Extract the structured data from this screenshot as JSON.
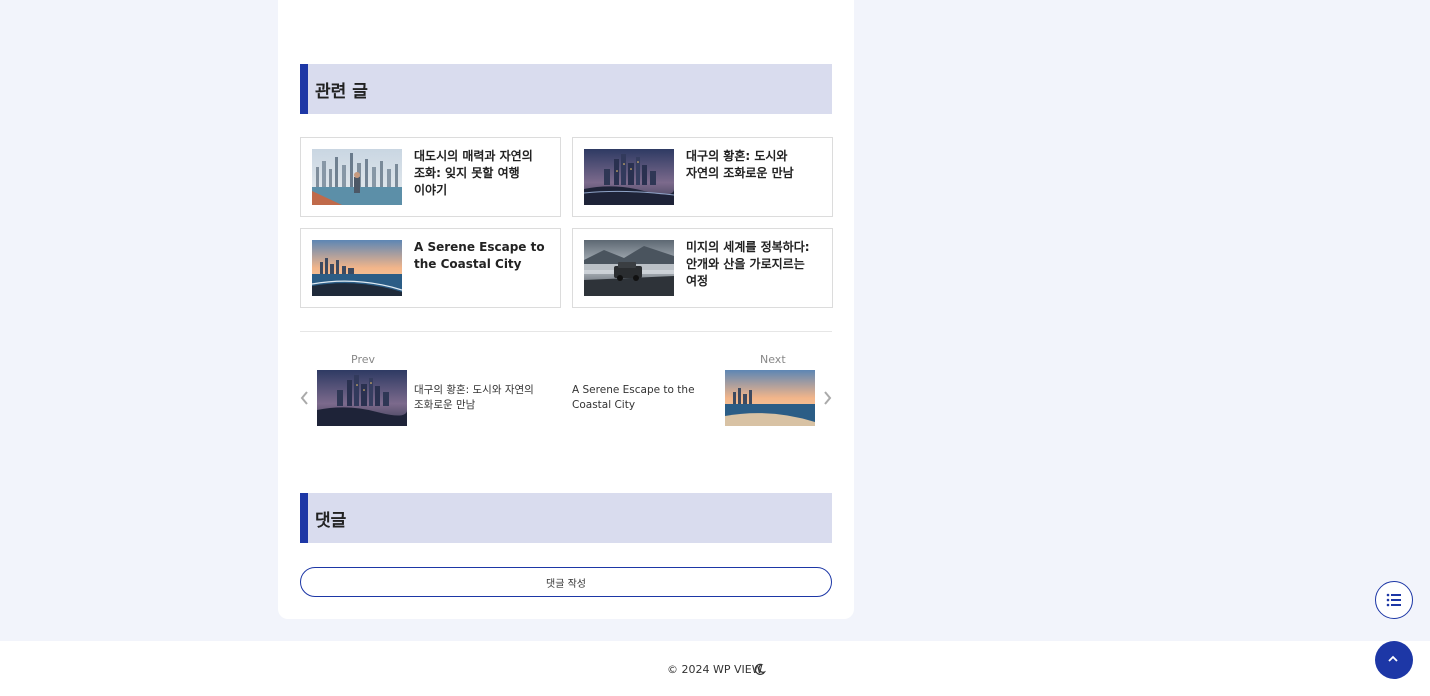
{
  "related": {
    "heading": "관련 글",
    "items": [
      {
        "title": "대도시의 매력과 자연의 조화: 잊지 못할 여행 이야기",
        "thumb": "city-waterfront-photo"
      },
      {
        "title": "대구의 황혼: 도시와 자연의 조화로운 만남",
        "thumb": "city-dusk-skyline-photo"
      },
      {
        "title": "A Serene Escape to the Coastal City",
        "thumb": "coastal-sunset-photo"
      },
      {
        "title": "미지의 세계를 정복하다: 안개와 산을 가로지르는 여정",
        "thumb": "suv-mountain-fog-photo"
      }
    ]
  },
  "post_nav": {
    "prev_label": "Prev",
    "prev_title": "대구의 황혼: 도시와 자연의 조화로운 만남",
    "next_label": "Next",
    "next_title": "A Serene Escape to the Coastal City"
  },
  "comments": {
    "heading": "댓글",
    "write_button": "댓글 작성"
  },
  "footer": {
    "copyright": "© 2024 WP VIEW."
  },
  "colors": {
    "accent": "#1d37a6",
    "section_bg": "#d9dcee",
    "page_bg": "#f2f4fb"
  },
  "icons": [
    "moon-icon",
    "toc-list-icon",
    "chevron-up-icon",
    "chevron-left-icon",
    "chevron-right-icon"
  ]
}
